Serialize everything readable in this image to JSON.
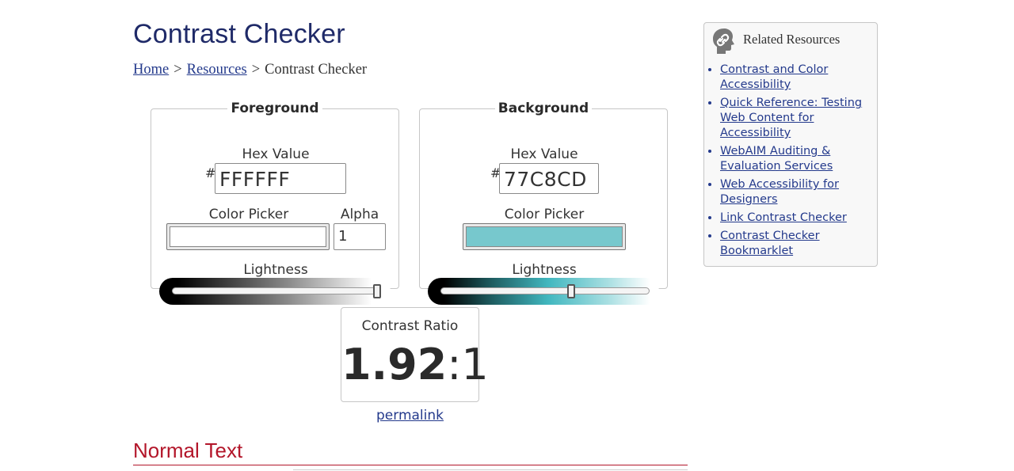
{
  "page": {
    "title": "Contrast Checker"
  },
  "breadcrumb": {
    "items": [
      "Home",
      "Resources",
      "Contrast Checker"
    ],
    "separator": ">"
  },
  "foreground": {
    "legend": "Foreground",
    "hex_label": "Hex Value",
    "hash": "#",
    "hex_value": "FFFFFF",
    "picker_label": "Color Picker",
    "picker_color": "#FFFFFF",
    "alpha_label": "Alpha",
    "alpha_value": "1",
    "lightness_label": "Lightness",
    "lightness_level": 1.0
  },
  "background": {
    "legend": "Background",
    "hex_label": "Hex Value",
    "hash": "#",
    "hex_value": "77C8CD",
    "picker_label": "Color Picker",
    "picker_color": "#77C8CD",
    "lightness_label": "Lightness",
    "lightness_level": 0.63
  },
  "result": {
    "label": "Contrast Ratio",
    "ratio": "1.92",
    "suffix": ":1",
    "permalink": "permalink"
  },
  "section": {
    "heading": "Normal Text"
  },
  "sidebar": {
    "title": "Related Resources",
    "icon": "link-head-icon",
    "links": [
      "Contrast and Color Accessibility",
      "Quick Reference: Testing Web Content for Accessibility",
      "WebAIM Auditing & Evaluation Services",
      "Web Accessibility for Designers",
      "Link Contrast Checker",
      "Contrast Checker Bookmarklet"
    ]
  },
  "colors": {
    "title": "#1f2a68",
    "link": "#243a8c",
    "section_heading": "#b3162a"
  }
}
